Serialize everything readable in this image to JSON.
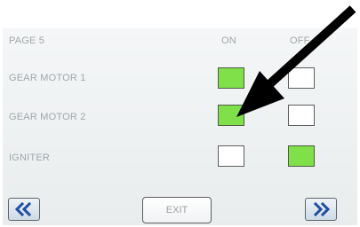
{
  "header": {
    "page_label": "PAGE 5",
    "col_on": "ON",
    "col_off": "OFF"
  },
  "rows": [
    {
      "label": "GEAR MOTOR 1",
      "on": true,
      "off": false
    },
    {
      "label": "GEAR MOTOR 2",
      "on": true,
      "off": false
    },
    {
      "label": "IGNITER",
      "on": false,
      "off": true
    }
  ],
  "footer": {
    "prev_icon": "double-chevron-left-icon",
    "exit_label": "EXIT",
    "next_icon": "double-chevron-right-icon"
  },
  "annotation": {
    "arrow_icon": "pointer-arrow-icon"
  },
  "colors": {
    "on_green": "#7fe04a",
    "text_gray": "#a0a6aa",
    "nav_blue": "#1f4fa0"
  }
}
